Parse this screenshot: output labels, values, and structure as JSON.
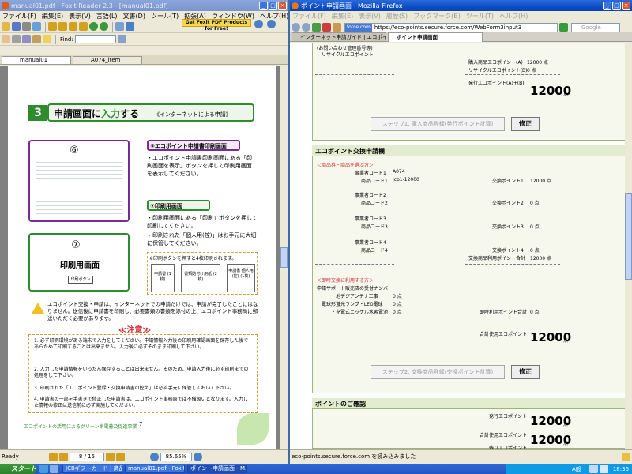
{
  "foxit": {
    "title": "manual01.pdf - Foxit Reader 2.3 - [manual01.pdf]",
    "menu": [
      "ファイル(F)",
      "編集(E)",
      "表示(V)",
      "言語(L)",
      "文書(D)",
      "ツール(T)",
      "拡張(A)",
      "ウィンドウ(W)",
      "ヘルプ(H)"
    ],
    "promo": "Get Foxit PDF Products for Free!",
    "find_label": "Find:",
    "tabs": [
      "manual01",
      "A074_item"
    ],
    "doc": {
      "step_no": "3",
      "step_title_a": "申請画面に",
      "step_title_b": "入力",
      "step_title_c": "する",
      "step_sub": "《インターネットによる申請》",
      "screen6_no": "⑥",
      "screen6_title": "⑥エコポイント申請書印刷画面",
      "screen6_text": "・エコポイント申請書印刷画面にある「印刷画面を表示」ボタンを押して印刷用画面を表示してください。",
      "screen7_no": "⑦",
      "screen7_label": "印刷用画面",
      "screen7_btn": "印刷ボタン",
      "screen7_title": "⑦印刷用画面",
      "screen7_text1": "・印刷用画面にある「印刷」ボタンを押して印刷してください。",
      "screen7_text2": "・印刷された「個人用(控)」はお手元に大切に保管してください。",
      "print_note": "※印刷ボタンを押すと4枚印刷されます。",
      "print_box1": "申請書 (1枚)",
      "print_box2": "書類貼付け用紙 (2枚)",
      "print_box3": "申請書 個人用(控) (1枚)",
      "warning": "エコポイント交換・申請は、インターネットでの申請だけでは、申請が完了したことにはなりません。送信後に申請書を印刷し、必要書類の書類を添付の上、エコポイント事務局に郵送いただく必要があります。",
      "caution_title": "≪注意≫",
      "caution": [
        "1. 必ず印刷環境がある端末で入力をしてください。申請情報入力後の印刷用確認画面を保存した後であらためて印刷することは出来ません。入力後に必ずそのまま印刷して下さい。",
        "2. 入力した申請情報をいったん保存することは出来ません。そのため、申請入力後に必ず印刷までの処理をして下さい。",
        "3. 印刷された「エコポイント登録・交換申請書の控え」は必ず手元に保管しておいて下さい。",
        "4. 申請書の一部を手書きで修正した申請書は、エコポイント事務局では不備扱いとなります。入力した情報の修正は送信前に必ず実施してください。"
      ],
      "footer": "エコポイントの活用によるグリーン家電普及促進事業",
      "page_no": "7"
    },
    "status": {
      "ready": "Ready",
      "page": "8 / 15",
      "zoom": "85.65%"
    }
  },
  "firefox": {
    "title": "ポイント申請画面 - Mozilla Firefox",
    "menu": [
      "ファイル(F)",
      "編集(E)",
      "表示(V)",
      "履歴(S)",
      "ブックマーク(B)",
      "ツール(T)",
      "ヘルプ(H)"
    ],
    "url": "https://eco-points.secure.force.com/WebForm3input3",
    "site_badge": "force.com",
    "search_placeholder": "Google",
    "tabs": [
      "インターネット申請ガイド | エコポイント...",
      "ポイント申請画面"
    ],
    "top": {
      "contact": "(お問い合わせ管理番号等)",
      "recycle": "リサイクルエコポイント",
      "purchase_label": "購入商品エコポイント(A)",
      "purchase_value": "12000 点",
      "recycle_label": "リサイクルエコポイント(B)",
      "recycle_value": "0 点",
      "issued_label": "発行エコポイント(A)+(B)",
      "issued_value": "12000",
      "unit": "点",
      "step_btn": "ステップ1. 購入商品登録(発行ポイント計算)",
      "fix_btn": "修正"
    },
    "exchange": {
      "heading": "エコポイント交換申請欄",
      "sub": "＜商品券・商品を選ぶ方＞",
      "biz1": "事業者コード1",
      "biz1_val": "A074",
      "item1": "商品コード1",
      "item1_val": "jcb1-12000",
      "pt1": "交換ポイント1",
      "pt1_val": "12000 点",
      "biz2": "事業者コード2",
      "item2": "商品コード2",
      "pt2": "交換ポイント2",
      "pt2_val": "0 点",
      "biz3": "事業者コード3",
      "item3": "商品コード3",
      "pt3": "交換ポイント3",
      "pt3_val": "0 点",
      "biz4": "事業者コード4",
      "item4": "商品コード4",
      "pt4": "交換ポイント4",
      "pt4_val": "0 点",
      "total_goods": "交換商品利用ポイント合計",
      "total_goods_val": "12000 点",
      "sub2": "＜即時交換に利用する方＞",
      "support": "申請サポート販売店の受付ナンバー",
      "digital": "地デジアンテナ工事",
      "digital_val": "0 点",
      "led": "電球形蛍光ランプ・LED電球",
      "led_val": "0 点",
      "ni": "・充電式ニッケル水素電池",
      "ni_val": "0 点",
      "instant": "即時利用ポイント合計",
      "instant_val": "0 点",
      "total_use": "合計使用エコポイント",
      "total_use_val": "12000",
      "unit": "点",
      "step_btn": "ステップ2. 交換商品登録(交換ポイント計算)",
      "fix_btn": "修正"
    },
    "confirm": {
      "heading": "ポイントのご確認",
      "issued": "発行エコポイント",
      "issued_val": "12000",
      "used": "合計使用エコポイント",
      "used_val": "12000",
      "rest": "残りエコポイント",
      "unit": "点"
    },
    "status": "eco-points.secure.force.com を読み込みました"
  },
  "taskbar": {
    "start": "スタート",
    "tasks": [
      "JCBギフトカード | 商品...",
      "manual01.pdf - Foxit ...",
      "ポイント申請画面 - M..."
    ],
    "time": "18:36",
    "ime": "A般"
  },
  "colors": {
    "accent_green": "#2e8b2e",
    "accent_purple": "#7a2a94",
    "warn_red": "#d03030"
  }
}
